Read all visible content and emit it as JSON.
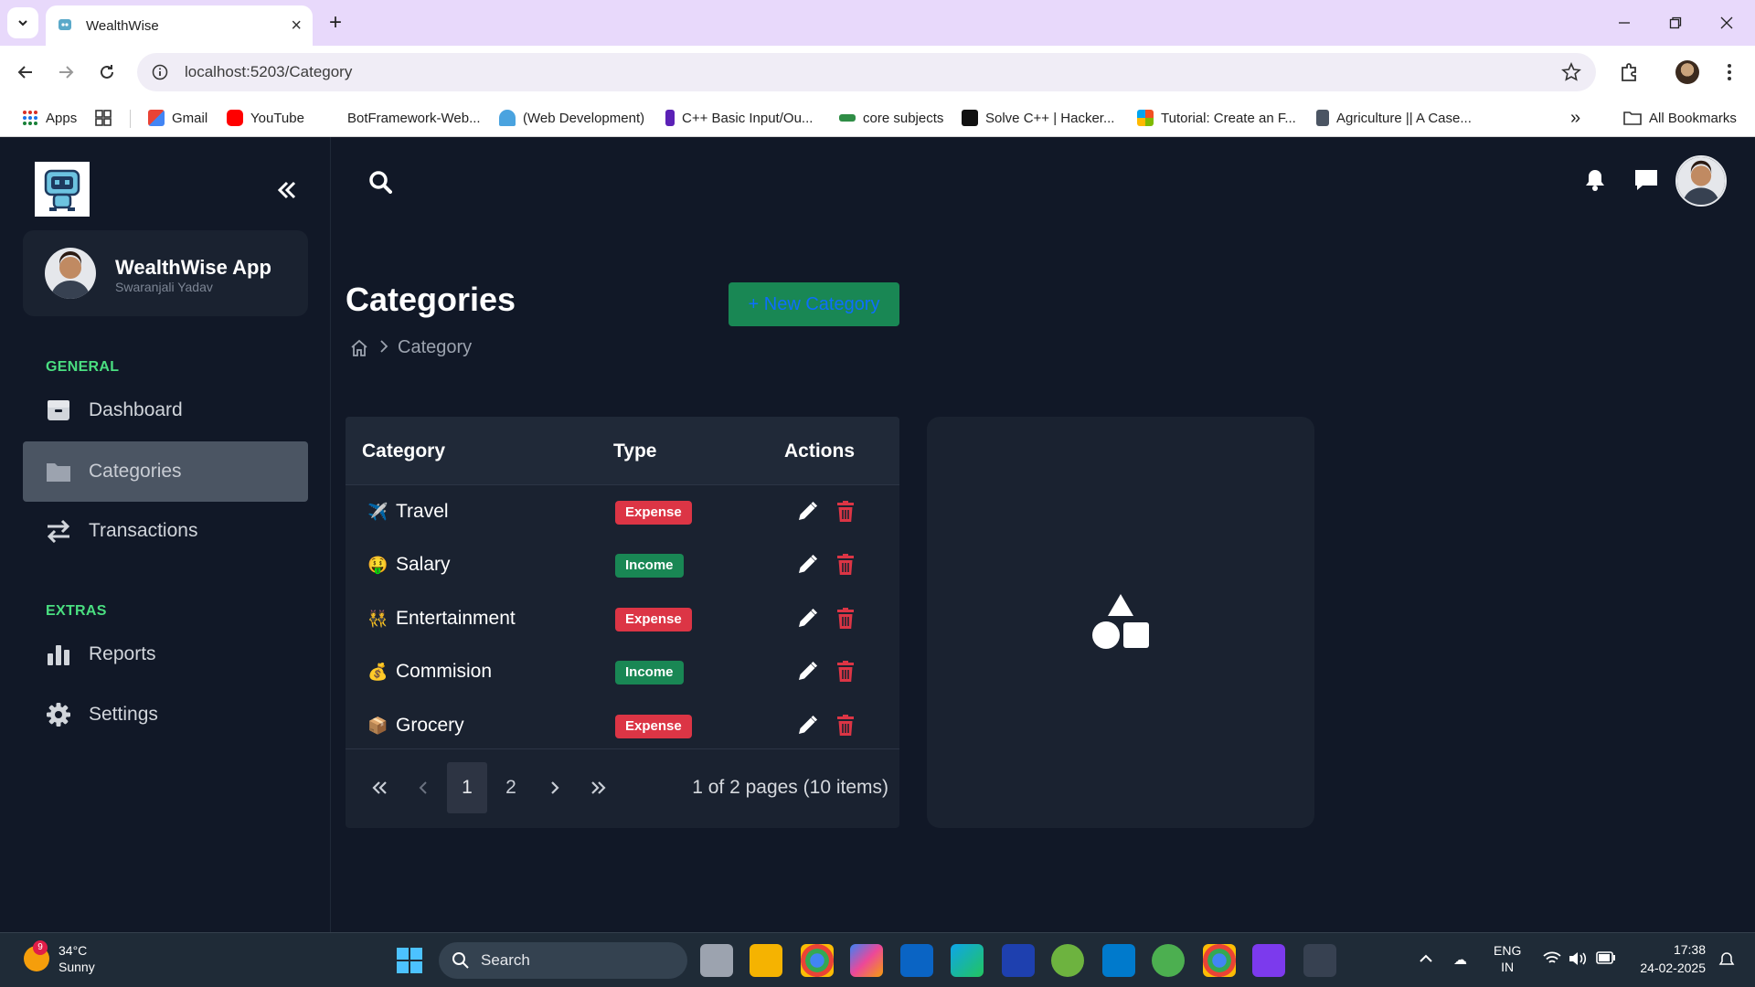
{
  "browser": {
    "tab_title": "WealthWise",
    "url": "localhost:5203/Category",
    "bookmarks": [
      {
        "label": "Apps"
      },
      {
        "label": "Gmail"
      },
      {
        "label": "YouTube"
      },
      {
        "label": "BotFramework-Web..."
      },
      {
        "label": "(Web Development)"
      },
      {
        "label": "C++ Basic Input/Ou..."
      },
      {
        "label": "core subjects"
      },
      {
        "label": "Solve C++ | Hacker..."
      },
      {
        "label": "Tutorial: Create an F..."
      },
      {
        "label": "Agriculture || A Case..."
      }
    ],
    "all_bookmarks": "All Bookmarks"
  },
  "sidebar": {
    "app_name": "WealthWise App",
    "user_name": "Swaranjali Yadav",
    "sections": [
      {
        "title": "GENERAL",
        "items": [
          {
            "label": "Dashboard"
          },
          {
            "label": "Categories"
          },
          {
            "label": "Transactions"
          }
        ]
      },
      {
        "title": "EXTRAS",
        "items": [
          {
            "label": "Reports"
          },
          {
            "label": "Settings"
          }
        ]
      }
    ]
  },
  "page": {
    "title": "Categories",
    "new_button": "+ New Category",
    "breadcrumb": {
      "current": "Category"
    }
  },
  "table": {
    "headers": [
      "Category",
      "Type",
      "Actions"
    ],
    "rows": [
      {
        "icon": "✈️",
        "name": "Travel",
        "type": "Expense"
      },
      {
        "icon": "🤑",
        "name": "Salary",
        "type": "Income"
      },
      {
        "icon": "👯",
        "name": "Entertainment",
        "type": "Expense"
      },
      {
        "icon": "💰",
        "name": "Commision",
        "type": "Income"
      },
      {
        "icon": "📦",
        "name": "Grocery",
        "type": "Expense"
      }
    ],
    "pager": {
      "pages": [
        "1",
        "2"
      ],
      "info": "1 of 2 pages (10 items)"
    }
  },
  "taskbar": {
    "weather_badge": "9",
    "temperature": "34°C",
    "condition": "Sunny",
    "search": "Search",
    "language": "ENG",
    "region": "IN",
    "time": "17:38",
    "date": "24-02-2025"
  },
  "colors": {
    "expense": "#dc3545",
    "income": "#198754",
    "accent_green": "#4ade80"
  }
}
